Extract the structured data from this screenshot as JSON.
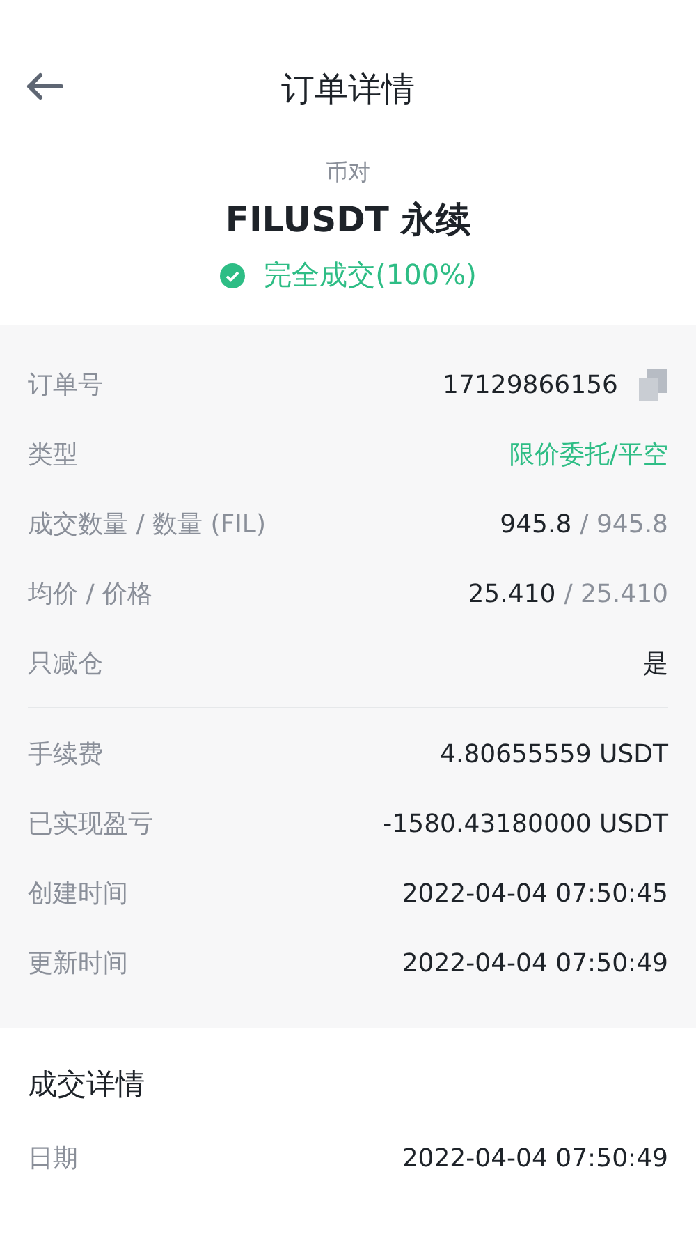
{
  "header": {
    "title": "订单详情"
  },
  "summary": {
    "pair_label": "币对",
    "symbol": "FILUSDT 永续",
    "status": "完全成交(100%)"
  },
  "order_groups": [
    {
      "rows": [
        {
          "kind": "copy",
          "label": "订单号",
          "value": "17129866156"
        },
        {
          "kind": "accent",
          "label": "类型",
          "value": "限价委托/平空"
        },
        {
          "kind": "pair",
          "label": "成交数量 / 数量 (FIL)",
          "value": "945.8",
          "secondary": "/ 945.8"
        },
        {
          "kind": "pair",
          "label": "均价 / 价格",
          "value": "25.410",
          "secondary": "/ 25.410"
        },
        {
          "kind": "text",
          "label": "只减仓",
          "value": "是"
        }
      ]
    },
    {
      "rows": [
        {
          "kind": "text",
          "label": "手续费",
          "value": "4.80655559 USDT"
        },
        {
          "kind": "text",
          "label": "已实现盈亏",
          "value": "-1580.43180000 USDT"
        },
        {
          "kind": "text",
          "label": "创建时间",
          "value": "2022-04-04 07:50:45"
        },
        {
          "kind": "text",
          "label": "更新时间",
          "value": "2022-04-04 07:50:49"
        }
      ]
    }
  ],
  "trade_details": {
    "title": "成交详情",
    "rows": [
      {
        "kind": "text",
        "label": "日期",
        "value": "2022-04-04 07:50:49"
      }
    ]
  }
}
